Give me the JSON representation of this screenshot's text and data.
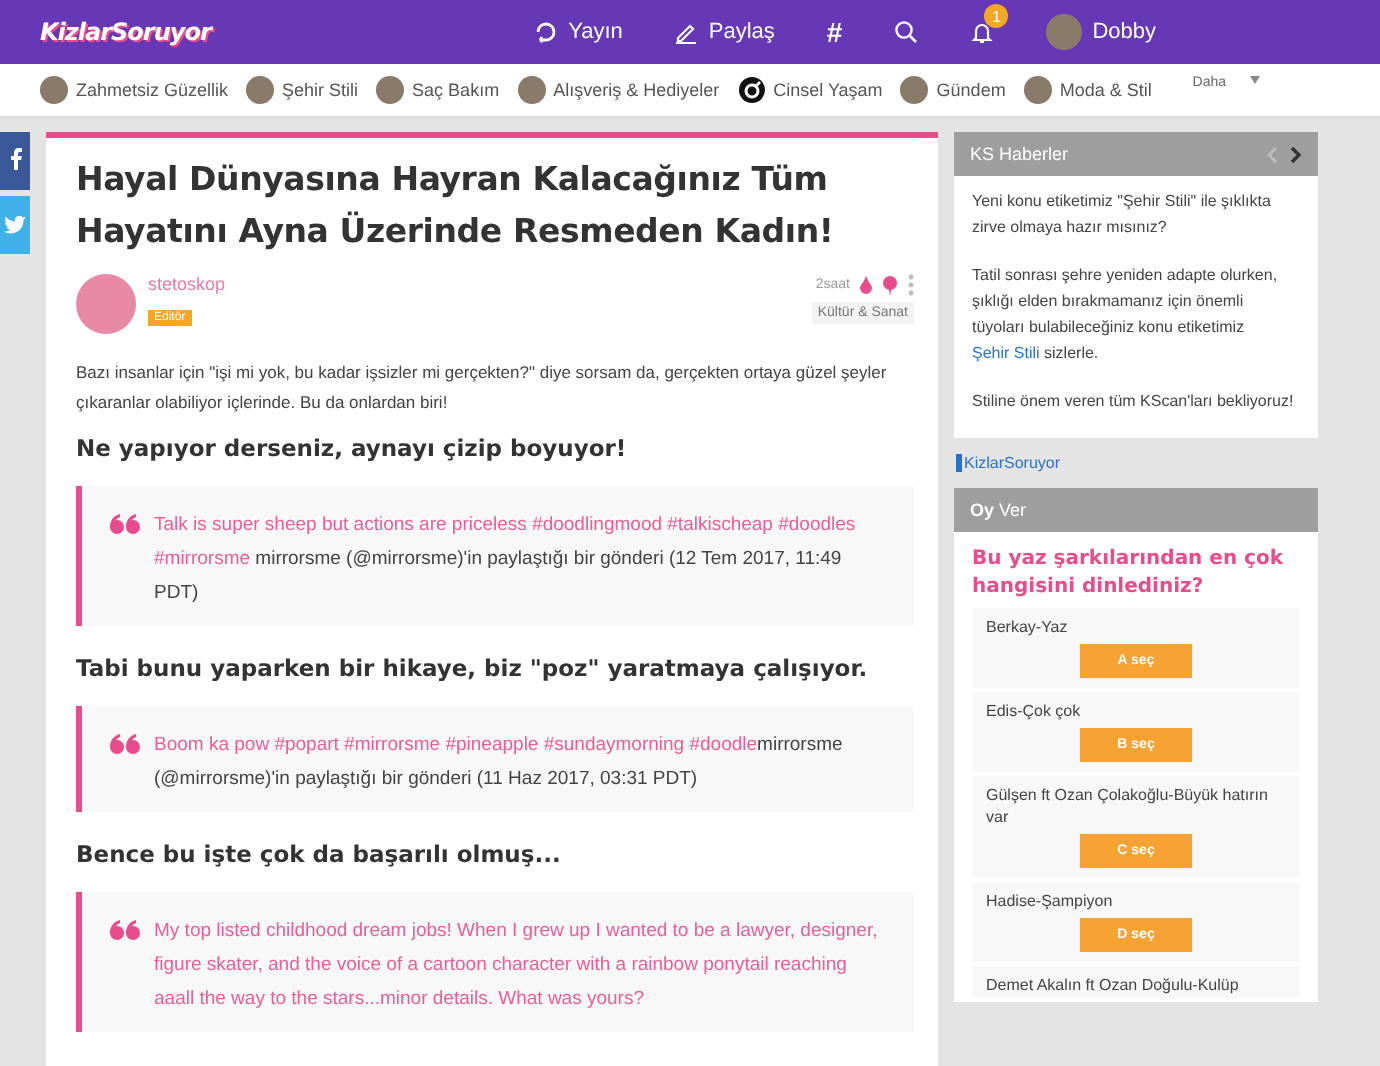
{
  "header": {
    "logo": "KizlarSoruyor",
    "nav": [
      {
        "kind": "live",
        "label": "Yayın"
      },
      {
        "kind": "share",
        "label": "Paylaş"
      },
      {
        "kind": "hash",
        "label": "#"
      },
      {
        "kind": "search"
      },
      {
        "kind": "bell",
        "badge": "1"
      },
      {
        "kind": "user",
        "label": "Dobby"
      }
    ]
  },
  "categories": [
    {
      "label": "Zahmetsiz Güzellik",
      "kind": "photo"
    },
    {
      "label": "Şehir Stili",
      "kind": "photo"
    },
    {
      "label": "Saç Bakım",
      "kind": "photo"
    },
    {
      "label": "Alışveriş & Hediyeler",
      "kind": "photo"
    },
    {
      "label": "Cinsel Yaşam",
      "kind": "ring"
    },
    {
      "label": "Gündem",
      "kind": "photo"
    },
    {
      "label": "Moda & Stil",
      "kind": "photo"
    }
  ],
  "more": "Daha",
  "article": {
    "title": "Hayal Dünyasına Hayran Kalacağınız Tüm Hayatını Ayna Üzerinde Resmeden Kadın!",
    "author": "stetoskop",
    "role": "Editör",
    "time": "2saat",
    "topic": "Kültür & Sanat",
    "blocks": [
      {
        "kind": "text",
        "text": "Bazı insanlar için \"işi mi yok, bu kadar işsizler mi gerçekten?\" diye sorsam da, gerçekten ortaya güzel şeyler çıkaranlar olabiliyor içlerinde. Bu da onlardan biri!"
      },
      {
        "kind": "heading",
        "text": "Ne yapıyor derseniz, aynayı çizip boyuyor!"
      },
      {
        "kind": "quote",
        "pink": "Talk is super sheep but actions are priceless #doodlingmood #talkischeap #doodles #mirrorsme",
        "text": " mirrorsme (@mirrorsme)'in paylaştığı bir gönderi (12 Tem 2017, 11:49 PDT)"
      },
      {
        "kind": "heading",
        "text": "Tabi bunu yaparken bir hikaye, biz \"poz\" yaratmaya çalışıyor."
      },
      {
        "kind": "quote",
        "pink": "Boom ka pow  #popart #mirrorsme #pineapple #sundaymorning #doodle",
        "text": "mirrorsme (@mirrorsme)'in paylaştığı bir gönderi (11 Haz 2017, 03:31 PDT)"
      },
      {
        "kind": "heading",
        "text": "Bence bu işte çok da başarılı olmuş..."
      },
      {
        "kind": "quote",
        "pink": "My top listed childhood dream jobs! When I grew up I wanted to be a lawyer, designer, figure skater, and the voice of a cartoon character with a rainbow ponytail reaching aaall the way to the stars...minor details. What was yours?"
      }
    ]
  },
  "news": {
    "title": "KS Haberler",
    "paragraphs": [
      [
        {
          "kind": "text",
          "text": "Yeni konu etiketimiz \"Şehir Stili\" ile şıklıkta zirve olmaya hazır mısınız?"
        }
      ],
      [
        {
          "kind": "text",
          "text": "Tatil sonrası şehre yeniden adapte olurken, şıklığı elden bırakmamanız için önemli tüyoları bulabileceğiniz konu etiketimiz "
        },
        {
          "kind": "link",
          "text": "Şehir Stili"
        },
        {
          "kind": "text",
          "text": " sizlerle."
        }
      ],
      [
        {
          "kind": "text",
          "text": "Stiline önem veren tüm KScan'ları bekliyoruz!"
        }
      ]
    ]
  },
  "brand_link": "KizlarSoruyor",
  "poll": {
    "title_bold": "Oy",
    "title": "Ver",
    "question": "Bu yaz şarkılarından en çok hangisini dinlediniz?",
    "options": [
      {
        "label": "Berkay-Yaz",
        "button": "A seç"
      },
      {
        "label": "Edis-Çok çok",
        "button": "B seç"
      },
      {
        "label": "Gülşen ft Ozan Çolakoğlu-Büyük hatırın var",
        "button": "C seç"
      },
      {
        "label": "Hadise-Şampiyon",
        "button": "D seç"
      },
      {
        "label": "Demet Akalın ft Ozan Doğulu-Kulüp"
      }
    ]
  }
}
